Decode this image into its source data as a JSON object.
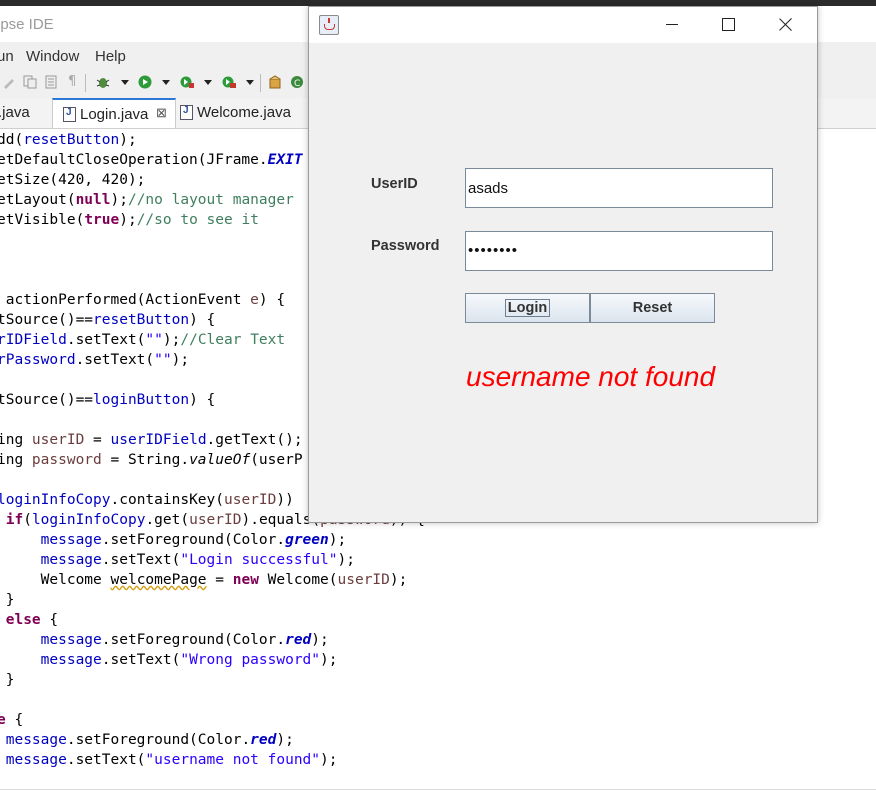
{
  "eclipse": {
    "title_partial": "ipse IDE",
    "menu": [
      "un",
      "Window",
      "Help"
    ],
    "tabs": [
      {
        "label": ".java",
        "active": false
      },
      {
        "label": "Login.java",
        "active": true,
        "close": "⊠"
      },
      {
        "label": "Welcome.java",
        "active": false
      }
    ],
    "code_lines": [
      [
        [
          "",
          "dd("
        ],
        [
          "fld",
          "resetButton"
        ],
        [
          "",
          ");"
        ]
      ],
      [
        [
          "",
          "etDefaultCloseOperation(JFrame."
        ],
        [
          "sfi",
          "EXIT"
        ]
      ],
      [
        [
          "",
          "etSize(420, 420);"
        ]
      ],
      [
        [
          "",
          "etLayout("
        ],
        [
          "kw",
          "null"
        ],
        [
          "",
          ");"
        ],
        [
          "cmt",
          "//no layout manager"
        ]
      ],
      [
        [
          "",
          "etVisible("
        ],
        [
          "kw",
          "true"
        ],
        [
          "",
          ");"
        ],
        [
          "cmt",
          "//so to see it"
        ]
      ],
      [],
      [],
      [],
      [
        [
          "",
          " actionPerformed(ActionEvent "
        ],
        [
          "var",
          "e"
        ],
        [
          "",
          ") {"
        ]
      ],
      [
        [
          "",
          "tSource()=="
        ],
        [
          "fld",
          "resetButton"
        ],
        [
          "",
          ") {"
        ]
      ],
      [
        [
          "fld",
          "rIDField"
        ],
        [
          "",
          ".setText("
        ],
        [
          "str",
          "\"\""
        ],
        [
          "",
          ");"
        ],
        [
          "cmt",
          "//Clear Text"
        ]
      ],
      [
        [
          "fld",
          "rPassword"
        ],
        [
          "",
          ".setText("
        ],
        [
          "str",
          "\"\""
        ],
        [
          "",
          ");"
        ]
      ],
      [],
      [
        [
          "",
          "tSource()=="
        ],
        [
          "fld",
          "loginButton"
        ],
        [
          "",
          ") {"
        ]
      ],
      [],
      [
        [
          "",
          "ing "
        ],
        [
          "var",
          "userID"
        ],
        [
          "",
          " = "
        ],
        [
          "fld",
          "userIDField"
        ],
        [
          "",
          ".getText();"
        ]
      ],
      [
        [
          "",
          "ing "
        ],
        [
          "var",
          "password"
        ],
        [
          "",
          " = String."
        ],
        [
          "itl",
          "valueOf"
        ],
        [
          "",
          "(userP"
        ]
      ],
      [],
      [
        [
          "fld",
          "loginInfoCopy"
        ],
        [
          "",
          ".containsKey("
        ],
        [
          "var",
          "userID"
        ],
        [
          "",
          "))"
        ]
      ],
      [
        [
          "",
          " "
        ],
        [
          "kw",
          "if"
        ],
        [
          "",
          "("
        ],
        [
          "fld",
          "loginInfoCopy"
        ],
        [
          "",
          ".get("
        ],
        [
          "var",
          "userID"
        ],
        [
          "",
          ").equals("
        ],
        [
          "var",
          "password"
        ],
        [
          "",
          ")) {"
        ]
      ],
      [
        [
          "",
          "     "
        ],
        [
          "fld",
          "message"
        ],
        [
          "",
          ".setForeground(Color."
        ],
        [
          "sfi",
          "green"
        ],
        [
          "",
          ");"
        ]
      ],
      [
        [
          "",
          "     "
        ],
        [
          "fld",
          "message"
        ],
        [
          "",
          ".setText("
        ],
        [
          "str",
          "\"Login successful\""
        ],
        [
          "",
          ");"
        ]
      ],
      [
        [
          "",
          "     Welcome "
        ],
        [
          "warn",
          "welcomePage"
        ],
        [
          "",
          " = "
        ],
        [
          "kw",
          "new"
        ],
        [
          "",
          " Welcome("
        ],
        [
          "var",
          "userID"
        ],
        [
          "",
          ");"
        ]
      ],
      [
        [
          "",
          " }"
        ]
      ],
      [
        [
          "",
          " "
        ],
        [
          "kw",
          "else"
        ],
        [
          "",
          " {"
        ]
      ],
      [
        [
          "",
          "     "
        ],
        [
          "fld",
          "message"
        ],
        [
          "",
          ".setForeground(Color."
        ],
        [
          "sfi",
          "red"
        ],
        [
          "",
          ");"
        ]
      ],
      [
        [
          "",
          "     "
        ],
        [
          "fld",
          "message"
        ],
        [
          "",
          ".setText("
        ],
        [
          "str",
          "\"Wrong password\""
        ],
        [
          "",
          ");"
        ]
      ],
      [
        [
          "",
          " }"
        ]
      ],
      [],
      [
        [
          "kw",
          "e"
        ],
        [
          "",
          " {"
        ]
      ],
      [
        [
          "",
          " "
        ],
        [
          "fld",
          "message"
        ],
        [
          "",
          ".setForeground(Color."
        ],
        [
          "sfi",
          "red"
        ],
        [
          "",
          ");"
        ]
      ],
      [
        [
          "",
          " "
        ],
        [
          "fld",
          "message"
        ],
        [
          "",
          ".setText("
        ],
        [
          "str",
          "\"username not found\""
        ],
        [
          "",
          ");"
        ]
      ]
    ]
  },
  "login_window": {
    "userid_label": "UserID",
    "password_label": "Password",
    "userid_value": "asads",
    "password_value": "••••••••",
    "login_button": "Login",
    "reset_button": "Reset",
    "message": "username not found",
    "message_color": "#ff0000"
  }
}
